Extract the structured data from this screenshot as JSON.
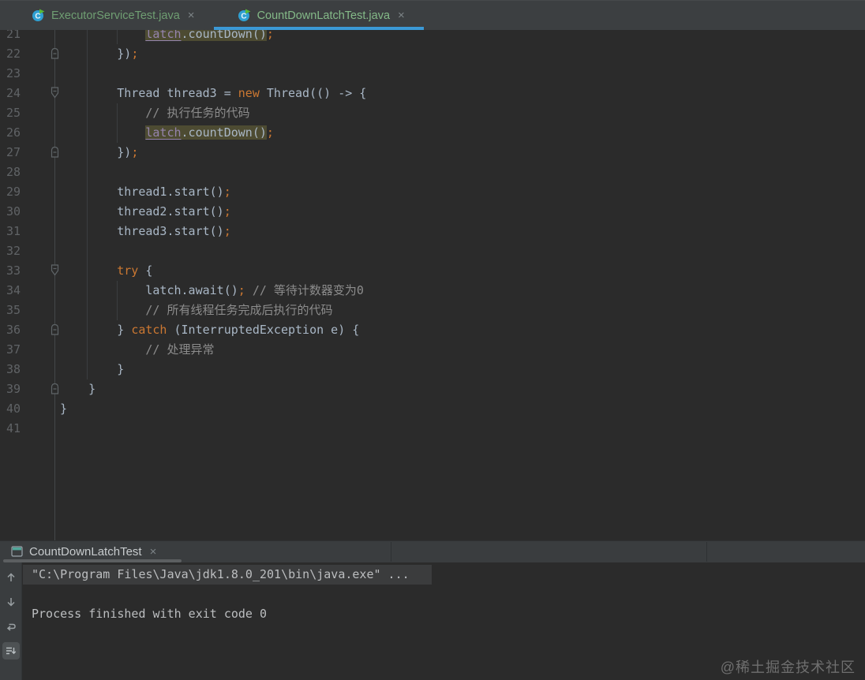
{
  "glyphs": {
    "close": "×"
  },
  "editor_tabs": [
    {
      "label": "ExecutorServiceTest.java",
      "active": false
    },
    {
      "label": "CountDownLatchTest.java",
      "active": true
    }
  ],
  "editor": {
    "lines": [
      {
        "num": "21",
        "fold": "",
        "code": [
          {
            "t": "            "
          },
          {
            "t": "latch",
            "c": "field hl"
          },
          {
            "t": ".countDown()",
            "c": "hl"
          },
          {
            "t": ";",
            "c": "semi"
          }
        ]
      },
      {
        "num": "22",
        "fold": "end",
        "code": [
          {
            "t": "        })"
          },
          {
            "t": ";",
            "c": "semi"
          }
        ]
      },
      {
        "num": "23",
        "fold": "",
        "code": []
      },
      {
        "num": "24",
        "fold": "start",
        "code": [
          {
            "t": "        Thread thread3 = "
          },
          {
            "t": "new",
            "c": "kw"
          },
          {
            "t": " Thread(() -> {"
          }
        ]
      },
      {
        "num": "25",
        "fold": "",
        "code": [
          {
            "t": "            "
          },
          {
            "t": "// 执行任务的代码",
            "c": "cmt"
          }
        ]
      },
      {
        "num": "26",
        "fold": "",
        "code": [
          {
            "t": "            "
          },
          {
            "t": "latch",
            "c": "field hl"
          },
          {
            "t": ".countDown()",
            "c": "hl"
          },
          {
            "t": ";",
            "c": "semi"
          }
        ]
      },
      {
        "num": "27",
        "fold": "end",
        "code": [
          {
            "t": "        })"
          },
          {
            "t": ";",
            "c": "semi"
          }
        ]
      },
      {
        "num": "28",
        "fold": "",
        "code": []
      },
      {
        "num": "29",
        "fold": "",
        "code": [
          {
            "t": "        thread1.start()"
          },
          {
            "t": ";",
            "c": "semi"
          }
        ]
      },
      {
        "num": "30",
        "fold": "",
        "code": [
          {
            "t": "        thread2.start()"
          },
          {
            "t": ";",
            "c": "semi"
          }
        ]
      },
      {
        "num": "31",
        "fold": "",
        "code": [
          {
            "t": "        thread3.start()"
          },
          {
            "t": ";",
            "c": "semi"
          }
        ]
      },
      {
        "num": "32",
        "fold": "",
        "code": []
      },
      {
        "num": "33",
        "fold": "start",
        "code": [
          {
            "t": "        "
          },
          {
            "t": "try",
            "c": "kw"
          },
          {
            "t": " {"
          }
        ]
      },
      {
        "num": "34",
        "fold": "",
        "code": [
          {
            "t": "            latch.await()"
          },
          {
            "t": ";",
            "c": "semi"
          },
          {
            "t": " "
          },
          {
            "t": "// 等待计数器变为0",
            "c": "cmt"
          }
        ]
      },
      {
        "num": "35",
        "fold": "",
        "code": [
          {
            "t": "            "
          },
          {
            "t": "// 所有线程任务完成后执行的代码",
            "c": "cmt"
          }
        ]
      },
      {
        "num": "36",
        "fold": "end",
        "code": [
          {
            "t": "        } "
          },
          {
            "t": "catch",
            "c": "kw"
          },
          {
            "t": " (InterruptedException e) {"
          }
        ]
      },
      {
        "num": "37",
        "fold": "",
        "code": [
          {
            "t": "            "
          },
          {
            "t": "// 处理异常",
            "c": "cmt"
          }
        ]
      },
      {
        "num": "38",
        "fold": "",
        "code": [
          {
            "t": "        }"
          }
        ]
      },
      {
        "num": "39",
        "fold": "end",
        "code": [
          {
            "t": "    }"
          }
        ]
      },
      {
        "num": "40",
        "fold": "",
        "code": [
          {
            "t": "}"
          }
        ]
      },
      {
        "num": "41",
        "fold": "",
        "code": []
      }
    ]
  },
  "run_panel": {
    "tab": {
      "label": "CountDownLatchTest"
    },
    "toolbar_icons": [
      "up-arrow",
      "down-arrow",
      "rerun",
      "scroll-to-end"
    ],
    "console": [
      {
        "text": "\"C:\\Program Files\\Java\\jdk1.8.0_201\\bin\\java.exe\" ...",
        "highlighted": true
      },
      {
        "text": ""
      },
      {
        "text": "Process finished with exit code 0"
      }
    ]
  },
  "watermark": "@稀土掘金技术社区",
  "colors": {
    "editor_bg": "#2b2b2b",
    "bar_bg": "#3c3f41",
    "active_tab_underline": "#3b99d6",
    "keyword": "#cc7832",
    "comment": "#8c8c8c",
    "plain_code": "#a9b7c6",
    "field": "#9584ad",
    "usage_highlight_bg": "#4d4b32",
    "line_number": "#606366",
    "tab_text_green": "#84ba88"
  }
}
